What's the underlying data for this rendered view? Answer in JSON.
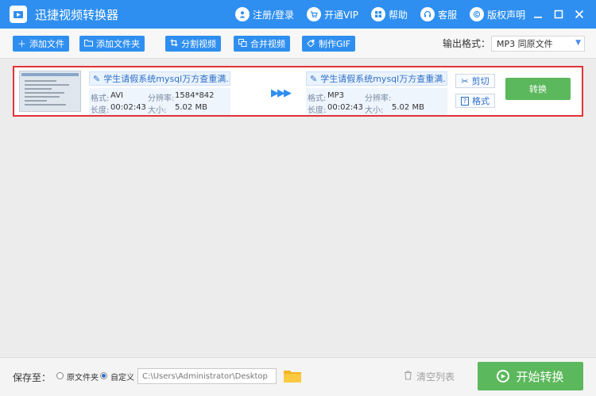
{
  "app": {
    "title": "迅捷视频转换器"
  },
  "top_links": [
    {
      "label": "注册/登录",
      "icon": "user-icon"
    },
    {
      "label": "开通VIP",
      "icon": "cart-icon"
    },
    {
      "label": "帮助",
      "icon": "grid-icon"
    },
    {
      "label": "客服",
      "icon": "headset-icon"
    },
    {
      "label": "版权声明",
      "icon": "copyright-icon"
    }
  ],
  "window_controls": [
    "minimize",
    "maximize",
    "close"
  ],
  "toolbar": {
    "add_file": "添加文件",
    "add_folder": "添加文件夹",
    "split_video": "分割视频",
    "merge_video": "合并视频",
    "make_gif": "制作GIF",
    "output_format_label": "输出格式：",
    "output_format_value": "MP3  同原文件"
  },
  "file": {
    "source": {
      "name": "学生请假系统mysql万方查重满..",
      "format_label": "格式:",
      "format": "AVI",
      "resolution_label": "分辨率:",
      "resolution": "1584*842",
      "duration_label": "长度:",
      "duration": "00:02:43",
      "size_label": "大小:",
      "size": "5.02 MB"
    },
    "target": {
      "name": "学生请假系统mysql万方查重满..",
      "format_label": "格式:",
      "format": "MP3",
      "resolution_label": "分辨率:",
      "resolution": "",
      "duration_label": "长度:",
      "duration": "00:02:43",
      "size_label": "大小:",
      "size": "5.02 MB"
    },
    "cut_label": "剪切",
    "format_btn_label": "格式",
    "convert_label": "转换"
  },
  "footer": {
    "save_to_label": "保存至：",
    "option_original": "原文件夹",
    "option_custom": "自定义",
    "selected_option": "custom",
    "path": "C:\\Users\\Administrator\\Desktop",
    "clear_list": "清空列表",
    "start_convert": "开始转换"
  },
  "colors": {
    "title_bar": "#2f8ff0",
    "accent": "#2f8ff0",
    "convert_green": "#5cb85c",
    "selection_border": "#e2323a"
  }
}
